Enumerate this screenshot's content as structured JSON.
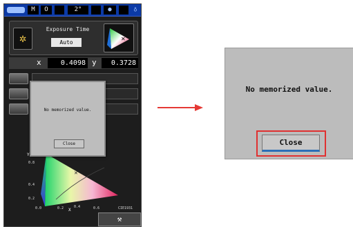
{
  "status_bar": {
    "segments": [
      "M",
      "O",
      "2°"
    ],
    "icons": [
      "battery-icon",
      "radio-icon",
      "lock-icon"
    ]
  },
  "exposure": {
    "label": "Exposure Time",
    "value": "Auto"
  },
  "coordinates": {
    "x_label": "x",
    "x_value": "0.4098",
    "y_label": "y",
    "y_value": "0.3728"
  },
  "mini_chart": {
    "y_axis_label": "Y",
    "x_axis_label": "X",
    "y_ticks": [
      "0.8",
      "0.4",
      "0.2"
    ],
    "x_ticks": [
      "0.0",
      "0.2",
      "0.4",
      "0.6"
    ],
    "standard_label": "CIE1931"
  },
  "dialog_small": {
    "message": "No memorized value.",
    "close_label": "Close"
  },
  "dialog_large": {
    "message": "No memorized value.",
    "close_label": "Close"
  },
  "colors": {
    "status_blue": "#0c3aa6",
    "dialog_gray": "#bcbcbc",
    "highlight_red": "#e03030",
    "arrow_red": "#e53935"
  }
}
